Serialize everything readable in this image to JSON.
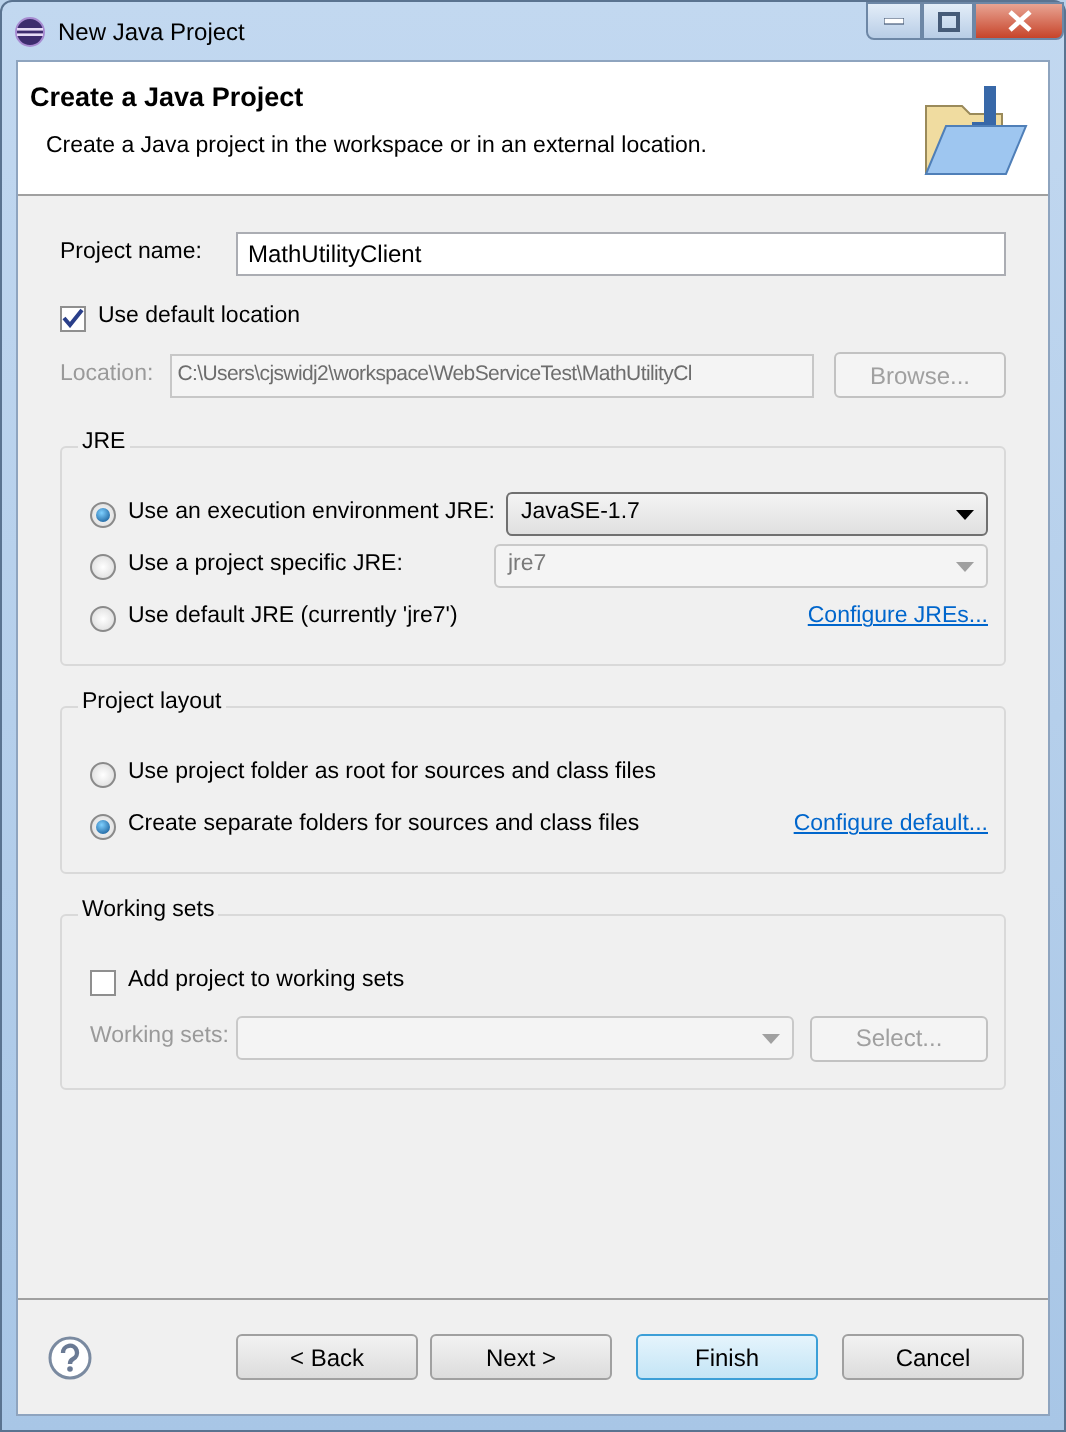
{
  "window": {
    "title": "New Java Project"
  },
  "header": {
    "title": "Create a Java Project",
    "description": "Create a Java project in the workspace or in an external location."
  },
  "project_name": {
    "label": "Project name:",
    "value": "MathUtilityClient"
  },
  "use_default_location": {
    "label": "Use default location",
    "checked": true
  },
  "location": {
    "label": "Location:",
    "value": "C:\\Users\\cjswidj2\\workspace\\WebServiceTest\\MathUtilityCl",
    "disabled": true,
    "button": "Browse..."
  },
  "groups": [
    {
      "title": "JRE",
      "rows": [
        {
          "kind": "radio",
          "label": "Use an execution environment JRE:",
          "selected": true,
          "dropdown": {
            "value": "JavaSE-1.7",
            "disabled": false
          }
        },
        {
          "kind": "radio",
          "label": "Use a project specific JRE:",
          "selected": false,
          "dropdown": {
            "value": "jre7",
            "disabled": true
          }
        },
        {
          "kind": "radio",
          "label": "Use default JRE (currently 'jre7')",
          "selected": false,
          "link": "Configure JREs..."
        }
      ]
    },
    {
      "title": "Project layout",
      "rows": [
        {
          "kind": "radio",
          "label": "Use project folder as root for sources and class files",
          "selected": false
        },
        {
          "kind": "radio",
          "label": "Create separate folders for sources and class files",
          "selected": true,
          "link": "Configure default..."
        }
      ]
    },
    {
      "title": "Working sets",
      "rows": [
        {
          "kind": "checkbox",
          "label": "Add project to working sets",
          "checked": false
        },
        {
          "kind": "field",
          "label": "Working sets:",
          "disabled": true,
          "button": "Select..."
        }
      ]
    }
  ],
  "buttons": [
    {
      "label": "< Back",
      "default": false
    },
    {
      "label": "Next >",
      "default": false
    },
    {
      "label": "Finish",
      "default": true
    },
    {
      "label": "Cancel",
      "default": false
    }
  ]
}
